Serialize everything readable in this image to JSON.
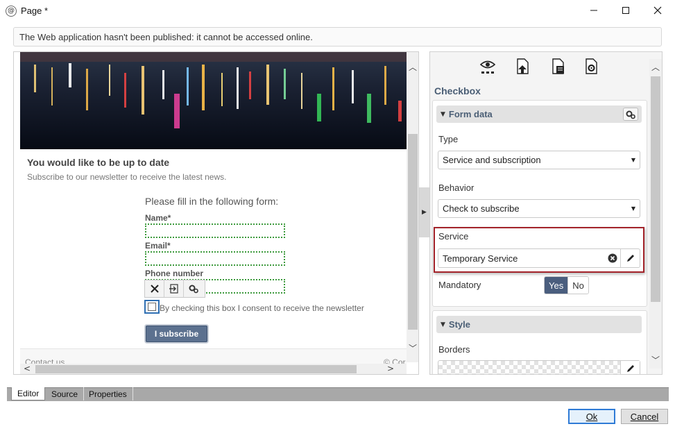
{
  "window": {
    "title": "Page *",
    "app_icon_glyph": "@",
    "minimize_icon": "minimize-icon",
    "maximize_icon": "maximize-icon",
    "close_icon": "close-icon"
  },
  "notice": {
    "text": "The Web application hasn't been published: it cannot be accessed online."
  },
  "editor": {
    "newsletter_title": "You would like to be up to date",
    "newsletter_subtitle": "Subscribe to our newsletter to receive the latest news.",
    "form_heading": "Please fill in the following form:",
    "fields": {
      "name_label": "Name*",
      "email_label": "Email*",
      "phone_label": "Phone number"
    },
    "consent_text": "By checking this box I consent to receive the newsletter",
    "subscribe_label": "I subscribe",
    "footer_left": "Contact us",
    "footer_right": "© Cor",
    "toolbar_icons": [
      "delete-icon",
      "move-icon",
      "settings-icon"
    ]
  },
  "panel": {
    "title": "Checkbox",
    "tools": [
      "preview-icon",
      "upload-page-icon",
      "document-icon",
      "page-settings-icon"
    ],
    "form_data": {
      "header": "Form data",
      "type_label": "Type",
      "type_value": "Service and subscription",
      "behavior_label": "Behavior",
      "behavior_value": "Check to subscribe",
      "service_label": "Service",
      "service_value": "Temporary Service",
      "mandatory_label": "Mandatory",
      "mandatory_yes": "Yes",
      "mandatory_no": "No",
      "mandatory_selected": "Yes"
    },
    "style": {
      "header": "Style",
      "borders_label": "Borders"
    }
  },
  "tabs": [
    {
      "label": "Editor",
      "active": true
    },
    {
      "label": "Source",
      "active": false
    },
    {
      "label": "Properties",
      "active": false
    }
  ],
  "buttons": {
    "ok_label": "Ok",
    "cancel_label": "Cancel"
  },
  "colors": {
    "accent": "#4a5e7e",
    "highlight": "#a3232a",
    "field_outline": "#3c9a3c",
    "focus": "#2f7bd6"
  }
}
